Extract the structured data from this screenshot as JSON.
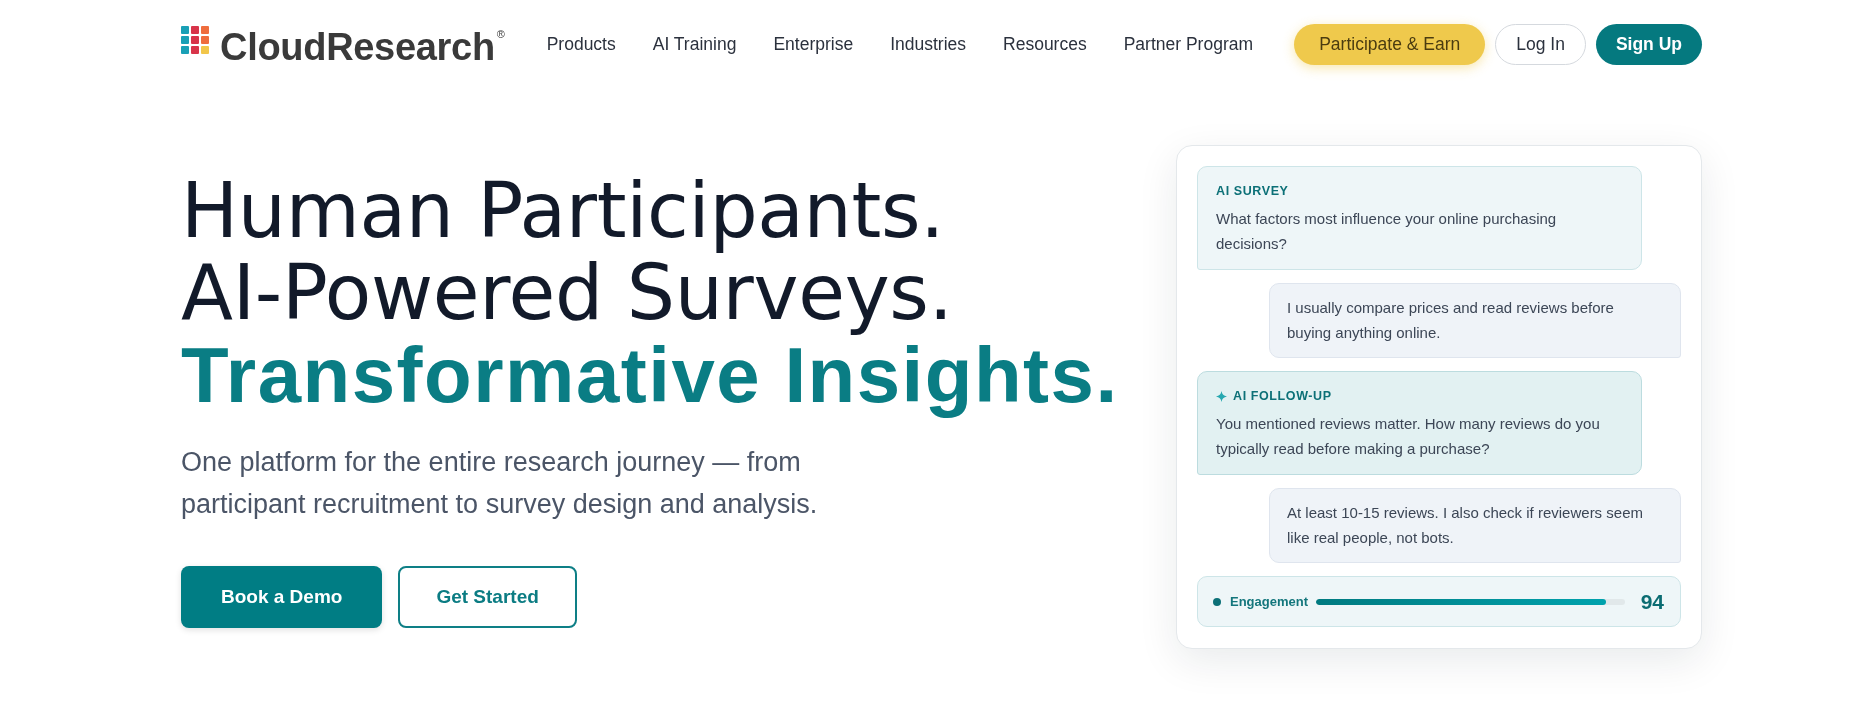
{
  "nav": {
    "logo": "CloudResearch$^{®}$",
    "links": [
      "Products",
      "AI Training",
      "Enterprise",
      "Industries",
      "Resources",
      "Partner Program"
    ],
    "buttons": [
      {
        "label": "Participate & Earn",
        "kind": "accent"
      },
      {
        "label": "Log In",
        "kind": "outline"
      },
      {
        "label": "Sign Up",
        "kind": "primary"
      }
    ]
  },
  "hero": {
    "headline": [
      {
        "text": "Human Participants.",
        "kind": "plain"
      },
      {
        "text": "AI-Powered Surveys.",
        "kind": "plain"
      },
      {
        "text": "Transformative Insights.",
        "kind": "accent"
      }
    ],
    "subtitle": "One platform for the entire research journey — from participant recruitment to survey design and analysis.",
    "buttons": [
      {
        "label": "Book a Demo",
        "kind": "primary"
      },
      {
        "label": "Get Started",
        "kind": "outline"
      }
    ]
  },
  "chat_card": {
    "messages": [
      {
        "kind": "question",
        "tag": "AI SURVEY",
        "text": "What factors most influence your online purchasing decisions?"
      },
      {
        "kind": "answer",
        "text": "I usually compare prices and read reviews before buying anything online."
      },
      {
        "kind": "followup",
        "tag": "AI FOLLOW-UP",
        "text": "You mentioned reviews matter. How many reviews do you typically read before making a purchase?"
      },
      {
        "kind": "answer",
        "text": "At least 10-15 reviews. I also check if reviewers seem like real people, not bots."
      }
    ],
    "meter": {
      "label": "Engagement",
      "level": 0.94,
      "reading": "94"
    }
  }
}
